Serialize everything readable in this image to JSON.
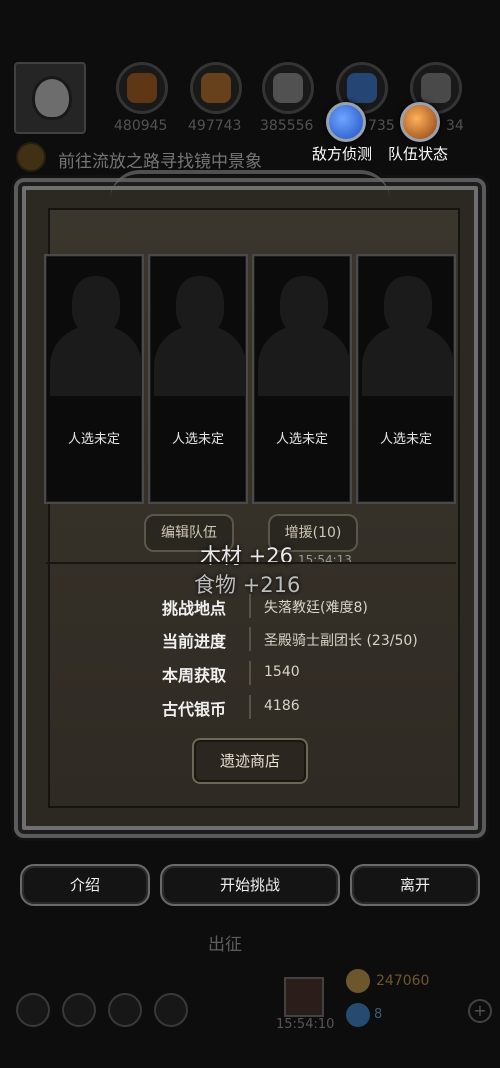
{
  "hud": {
    "resources": [
      {
        "icon": "wood-icon",
        "value": "480945",
        "color": "#a35a1d"
      },
      {
        "icon": "leather-icon",
        "value": "497743",
        "color": "#b26a2a"
      },
      {
        "icon": "stone-icon",
        "value": "385556",
        "color": "#8a8a8a"
      },
      {
        "icon": "crystal-icon",
        "value": "735",
        "color": "#3a73c9"
      },
      {
        "icon": "food-icon",
        "value": "34",
        "color": "#7a7a7a"
      }
    ],
    "quest_text": "前往流放之路寻找镜中景象",
    "enemy_scout_label": "敌方侦测",
    "team_status_label": "队伍状态"
  },
  "panel": {
    "slots": [
      {
        "label": "人选未定"
      },
      {
        "label": "人选未定"
      },
      {
        "label": "人选未定"
      },
      {
        "label": "人选未定"
      }
    ],
    "edit_team_label": "编辑队伍",
    "reinforce_label": "增援(10)",
    "float_wood": "木材 +26",
    "float_time": "15:54:13",
    "float_food": "食物 +216",
    "info": [
      {
        "label": "挑战地点",
        "value": "失落教廷(难度8)"
      },
      {
        "label": "当前进度",
        "value": "圣殿骑士副团长 (23/50)"
      },
      {
        "label": "本周获取",
        "value": "1540"
      },
      {
        "label": "古代银币",
        "value": "4186"
      }
    ],
    "shop_label": "遗迹商店"
  },
  "actions": {
    "intro_label": "介绍",
    "start_label": "开始挑战",
    "leave_label": "离开"
  },
  "bottom_hud": {
    "march_label": "出征",
    "chest_time": "15:54:10",
    "gold_value": "247060",
    "gem_value": "8"
  },
  "colors": {
    "orb_blue": "#2e6be0",
    "orb_orange": "#e0741a"
  }
}
